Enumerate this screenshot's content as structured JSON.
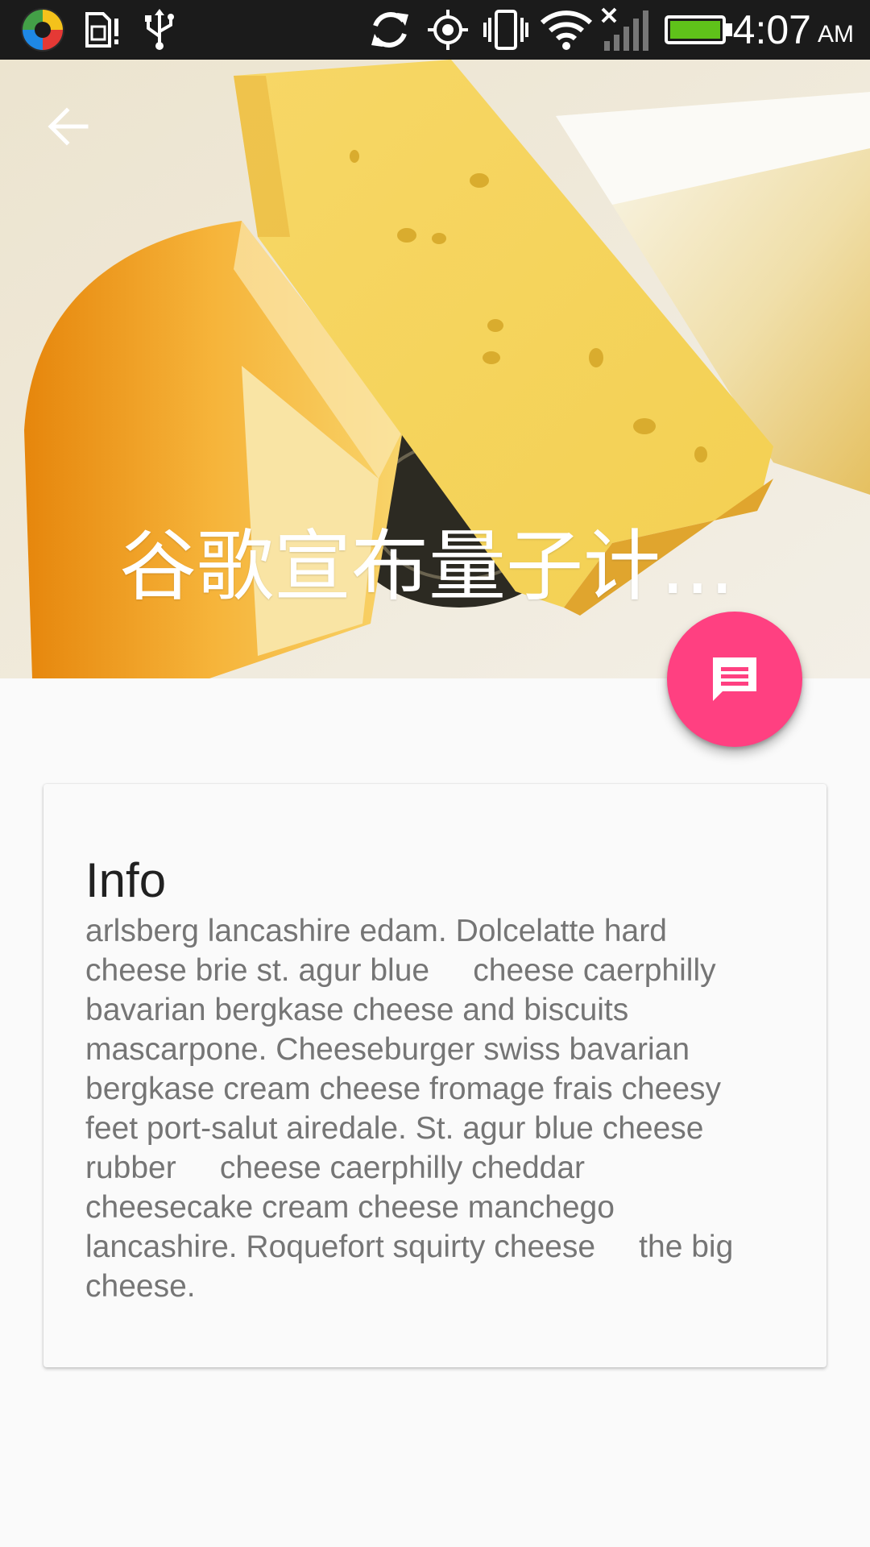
{
  "status_bar": {
    "time": "4:07",
    "ampm": "AM",
    "icons": [
      "app-logo-icon",
      "sim-alert-icon",
      "usb-icon",
      "sync-icon",
      "gps-icon",
      "vibrate-icon",
      "wifi-icon",
      "no-signal-icon",
      "battery-icon"
    ]
  },
  "header": {
    "title": "谷歌宣布量子计...",
    "back_icon": "arrow-back-icon",
    "image": "cheese-photo"
  },
  "fab": {
    "icon": "message-icon",
    "color": "#ff4081"
  },
  "card": {
    "title": "Info",
    "body": "arlsberg lancashire edam. Dolcelatte hard\ncheese brie st. agur blue     cheese caerphilly\nbavarian bergkase cheese and biscuits\nmascarpone. Cheeseburger swiss bavarian\nbergkase cream cheese fromage frais cheesy\nfeet port-salut airedale. St. agur blue cheese\nrubber     cheese caerphilly cheddar\ncheesecake cream cheese manchego\nlancashire. Roquefort squirty cheese     the big\ncheese."
  },
  "colors": {
    "accent": "#ff4081",
    "background": "#fafafa",
    "status_bar": "#1b1b1b"
  }
}
